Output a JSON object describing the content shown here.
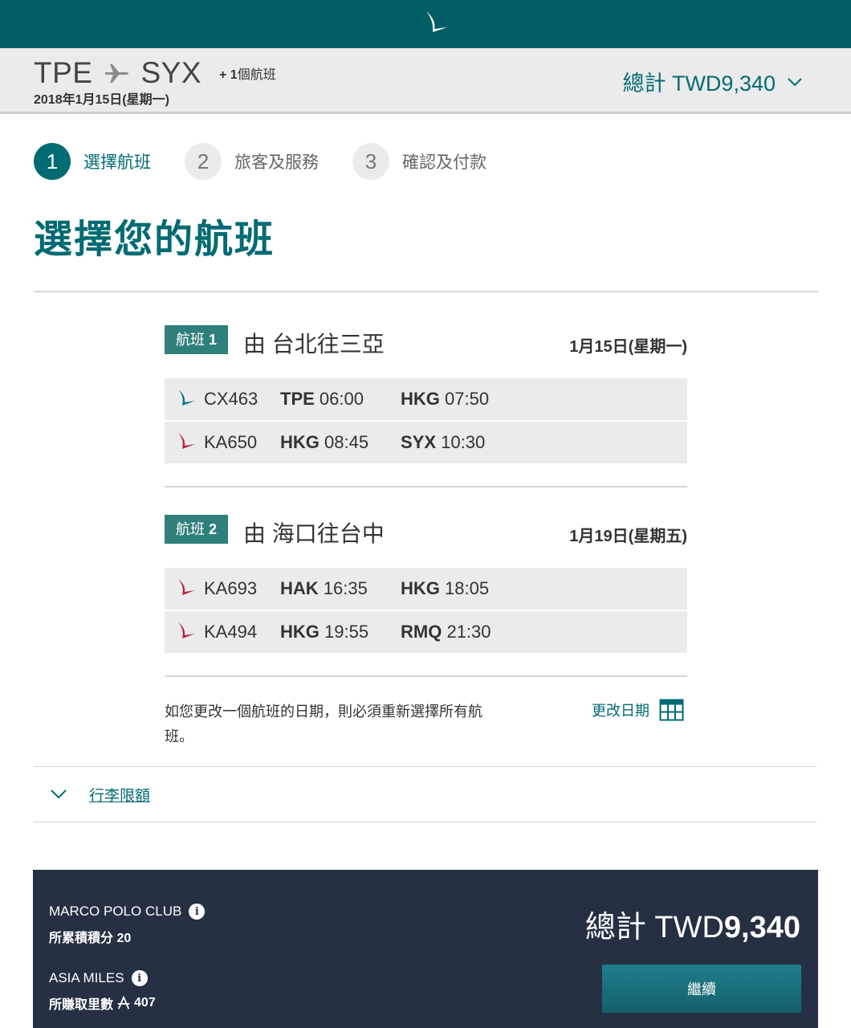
{
  "header": {
    "origin": "TPE",
    "destination": "SYX",
    "extra_prefix": "+ 1",
    "extra_label": "個航班",
    "date": "2018年1月15日(星期一)",
    "total": "總計 TWD9,340"
  },
  "steps": [
    {
      "num": "1",
      "label": "選擇航班"
    },
    {
      "num": "2",
      "label": "旅客及服務"
    },
    {
      "num": "3",
      "label": "確認及付款"
    }
  ],
  "title": "選擇您的航班",
  "flights": [
    {
      "tag": "航班",
      "tag_num": "1",
      "route": "由 台北往三亞",
      "date": "1月15日(星期一)",
      "segments": [
        {
          "flight": "CX463",
          "dep_code": "TPE",
          "dep_time": "06:00",
          "arr_code": "HKG",
          "arr_time": "07:50",
          "airline_color": "#00757a"
        },
        {
          "flight": "KA650",
          "dep_code": "HKG",
          "dep_time": "08:45",
          "arr_code": "SYX",
          "arr_time": "10:30",
          "airline_color": "#b5223c"
        }
      ]
    },
    {
      "tag": "航班",
      "tag_num": "2",
      "route": "由 海口往台中",
      "date": "1月19日(星期五)",
      "segments": [
        {
          "flight": "KA693",
          "dep_code": "HAK",
          "dep_time": "16:35",
          "arr_code": "HKG",
          "arr_time": "18:05",
          "airline_color": "#b5223c"
        },
        {
          "flight": "KA494",
          "dep_code": "HKG",
          "dep_time": "19:55",
          "arr_code": "RMQ",
          "arr_time": "21:30",
          "airline_color": "#b5223c"
        }
      ]
    }
  ],
  "notice": "如您更改一個航班的日期，則必須重新選擇所有航班。",
  "change_date": "更改日期",
  "baggage": "行李限額",
  "footer": {
    "mpc_label": "MARCO POLO CLUB",
    "mpc_sub": "所累積積分 20",
    "am_label": "ASIA MILES",
    "am_sub_prefix": "所賺取里數",
    "am_sub_value": "407",
    "total_prefix": "總計 TWD",
    "total_amount": "9,340",
    "continue": "繼續"
  },
  "colors": {
    "brand_teal": "#005d63",
    "accent": "#006b73",
    "footer_bg": "#253143"
  }
}
